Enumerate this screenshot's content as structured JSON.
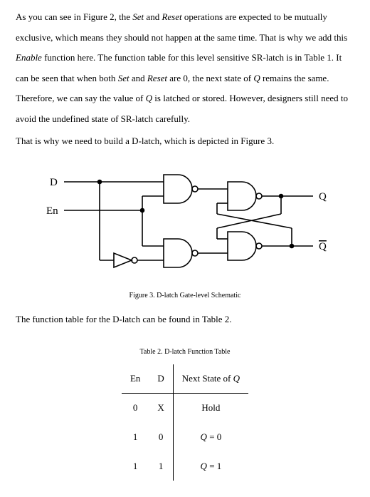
{
  "para1_a": "As you can see in Figure 2, the ",
  "para1_set": "Set",
  "para1_b": " and ",
  "para1_reset": "Reset",
  "para1_c": " operations are expected to be mutually exclusive, which means they should not happen at the same time. That is why we add this ",
  "para1_enable": "Enable",
  "para1_d": " function here. The function table for this level sensitive SR-latch is in Table 1. It can be seen that when both ",
  "para1_set2": "Set",
  "para1_e": " and ",
  "para1_reset2": "Reset",
  "para1_f": " are 0, the next state of ",
  "para1_Q1": "Q",
  "para1_g": " remains the same. Therefore, we can say the value of ",
  "para1_Q2": "Q",
  "para1_h": " is latched or stored. However, designers still need to avoid the undefined state of SR-latch carefully.",
  "para2": "That is why we need to build a D-latch, which is depicted in Figure 3.",
  "fig_labels": {
    "D": "D",
    "En": "En",
    "Q": "Q",
    "Qbar": "Q"
  },
  "fig_caption": "Figure 3. D-latch Gate-level Schematic",
  "para3": "The function table for the D-latch can be found in Table 2.",
  "table_caption": "Table 2. D-latch Function Table",
  "table": {
    "head": {
      "en": "En",
      "d": "D",
      "next_a": "Next State of ",
      "next_q": "Q"
    },
    "rows": [
      {
        "en": "0",
        "d": "X",
        "next": "Hold",
        "is_q": false
      },
      {
        "en": "1",
        "d": "0",
        "next_q": "Q",
        "next_eq": " = 0",
        "is_q": true
      },
      {
        "en": "1",
        "d": "1",
        "next_q": "Q",
        "next_eq": " = 1",
        "is_q": true
      }
    ]
  }
}
